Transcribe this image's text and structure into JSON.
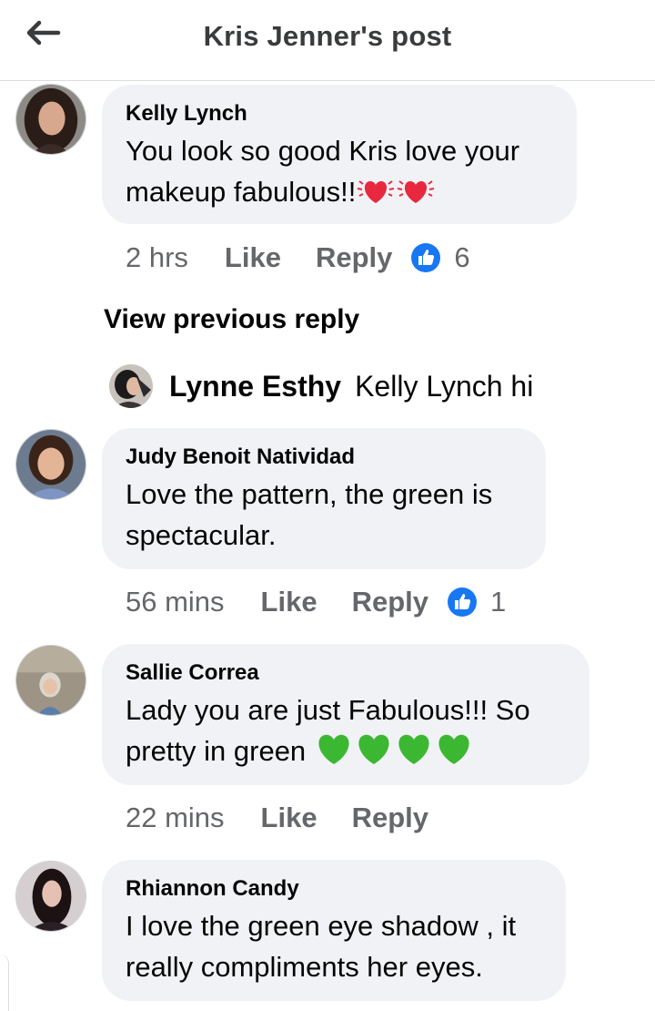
{
  "header": {
    "title": "Kris Jenner's post",
    "back_icon": "arrow-left-icon"
  },
  "comments": [
    {
      "author": "Kelly Lynch",
      "text_line1": "You look so good Kris love your",
      "text_line2": "makeup fabulous!!",
      "emoji": [
        "beating-heart-icon",
        "beating-heart-icon"
      ],
      "time": "2 hrs",
      "like_label": "Like",
      "reply_label": "Reply",
      "reactions": "6"
    },
    {
      "author": "Judy Benoit Natividad",
      "text_line1": "Love the pattern, the green is",
      "text_line2": "spectacular.",
      "time": "56 mins",
      "like_label": "Like",
      "reply_label": "Reply",
      "reactions": "1"
    },
    {
      "author": "Sallie Correa",
      "text_line1": "Lady you are just Fabulous!!!  So",
      "text_line2": "pretty in green",
      "emoji": [
        "green-heart-icon",
        "green-heart-icon",
        "green-heart-icon",
        "green-heart-icon"
      ],
      "time": "22 mins",
      "like_label": "Like",
      "reply_label": "Reply"
    },
    {
      "author": "Rhiannon Candy",
      "text_line1": "I love the green eye shadow , it",
      "text_line2": "really compliments her eyes."
    }
  ],
  "view_previous": "View previous reply",
  "reply_preview": {
    "author": "Lynne Esthy",
    "text": "Kelly Lynch hi"
  },
  "colors": {
    "like_blue": "#1877f2",
    "bubble": "#f0f2f5",
    "meta": "#65676b",
    "heart_red": "#e8283f",
    "heart_green": "#3cb731"
  }
}
